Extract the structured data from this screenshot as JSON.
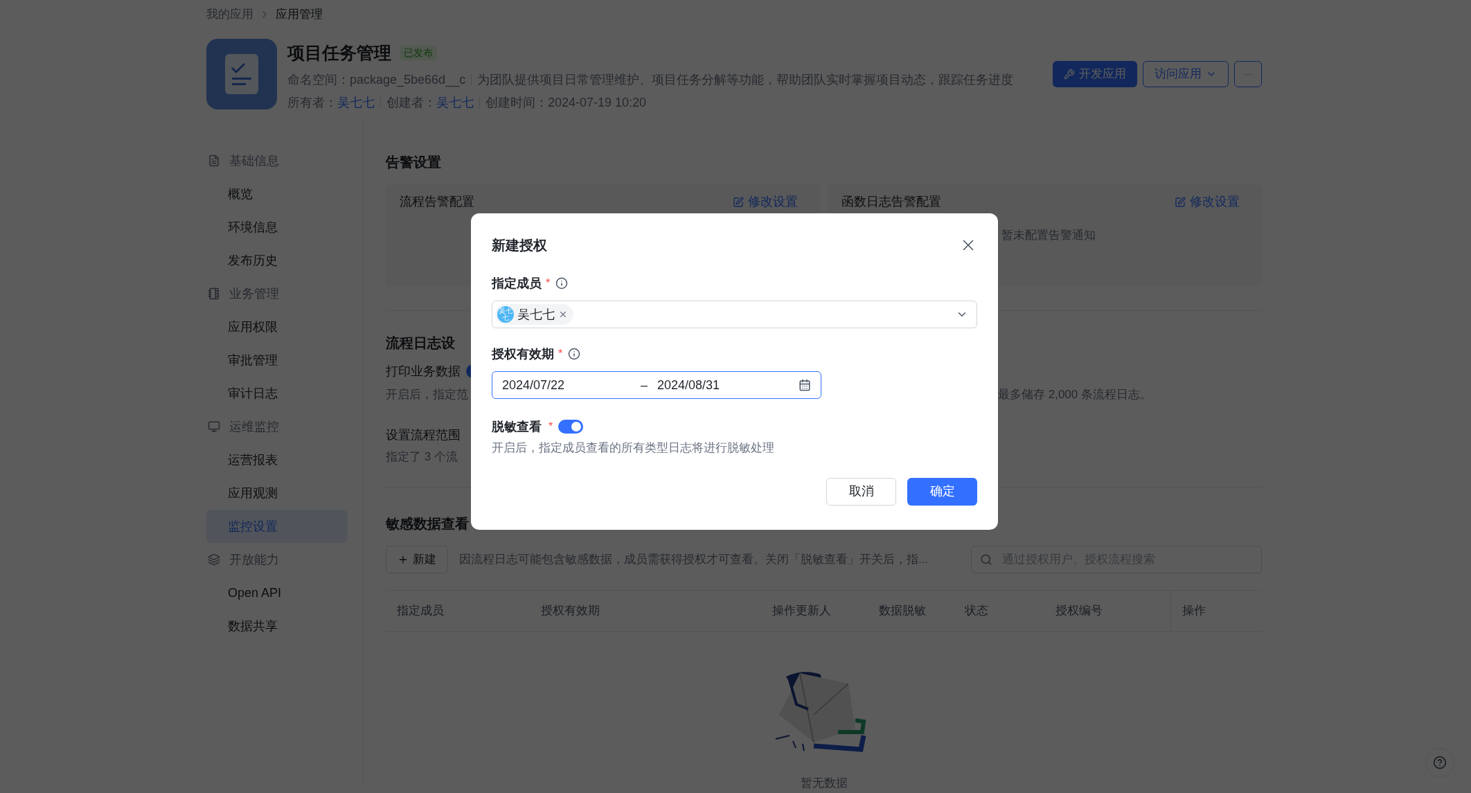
{
  "breadcrumb": [
    "我的应用",
    "应用管理"
  ],
  "app": {
    "title": "项目任务管理",
    "status": "已发布",
    "namespace_label": "命名空间：",
    "namespace": "package_5be66d__c",
    "description": "为团队提供项目日常管理维护、项目任务分解等功能，帮助团队实时掌握项目动态，跟踪任务进度",
    "owner_label": "所有者：",
    "owner": "吴七七",
    "creator_label": "创建者：",
    "creator": "吴七七",
    "created_label": "创建时间：",
    "created": "2024-07-19 10:20",
    "buttons": [
      {
        "kind": "primary",
        "label": "开发应用"
      },
      {
        "kind": "dropdown",
        "label": "访问应用"
      },
      {
        "kind": "more",
        "label": "···"
      }
    ]
  },
  "sidebar": [
    {
      "kind": "info",
      "label": "基础信息",
      "children": [
        {
          "label": "概览",
          "selected": false
        },
        {
          "label": "环境信息",
          "selected": false
        },
        {
          "label": "发布历史",
          "selected": false
        }
      ]
    },
    {
      "kind": "business",
      "label": "业务管理",
      "children": [
        {
          "label": "应用权限",
          "selected": false
        },
        {
          "label": "审批管理",
          "selected": false
        },
        {
          "label": "审计日志",
          "selected": false
        }
      ]
    },
    {
      "kind": "ops",
      "label": "运维监控",
      "children": [
        {
          "label": "运营报表",
          "selected": false
        },
        {
          "label": "应用观测",
          "selected": false
        },
        {
          "label": "监控设置",
          "selected": true
        }
      ]
    },
    {
      "kind": "open",
      "label": "开放能力",
      "children": [
        {
          "label": "Open API",
          "selected": false
        },
        {
          "label": "数据共享",
          "selected": false
        }
      ]
    }
  ],
  "alert_settings": {
    "title": "告警设置",
    "cards": [
      {
        "title": "流程告警配置",
        "action": "修改设置"
      },
      {
        "title": "函数日志告警配置",
        "action": "修改设置",
        "empty_text": "暂未配置告警通知"
      }
    ]
  },
  "log_settings": {
    "title": "流程日志设",
    "print": {
      "label": "打印业务数据",
      "on": true,
      "description": "开启后，指定范",
      "description_tail": "最多储存 2,000 条流程日志。"
    },
    "scope": {
      "label": "设置流程范围",
      "description": "指定了 3 个流"
    }
  },
  "sensitive": {
    "title": "敏感数据查看",
    "new_button": "新建",
    "notice": "因流程日志可能包含敏感数据，成员需获得授权才可查看。关闭「脱敏查看」开关后，指...",
    "search_placeholder": "通过授权用户、授权流程搜索",
    "columns": [
      "指定成员",
      "授权有效期",
      "操作更新人",
      "数据脱敏",
      "状态",
      "授权编号",
      "操作"
    ],
    "empty_text": "暂无数据"
  },
  "dialog": {
    "title": "新建授权",
    "member": {
      "label": "指定成员",
      "required_mark": "*",
      "tag": "吴七七",
      "avatar_text": "吴七七"
    },
    "period": {
      "label": "授权有效期",
      "required_mark": "*",
      "start": "2024/07/22",
      "separator": "–",
      "end": "2024/08/31"
    },
    "mask": {
      "label": "脱敏查看",
      "required_mark": "*",
      "on": true,
      "description": "开启后，指定成员查看的所有类型日志将进行脱敏处理"
    },
    "buttons": [
      {
        "kind": "secondary",
        "label": "取消"
      },
      {
        "kind": "primary",
        "label": "确定"
      }
    ]
  }
}
